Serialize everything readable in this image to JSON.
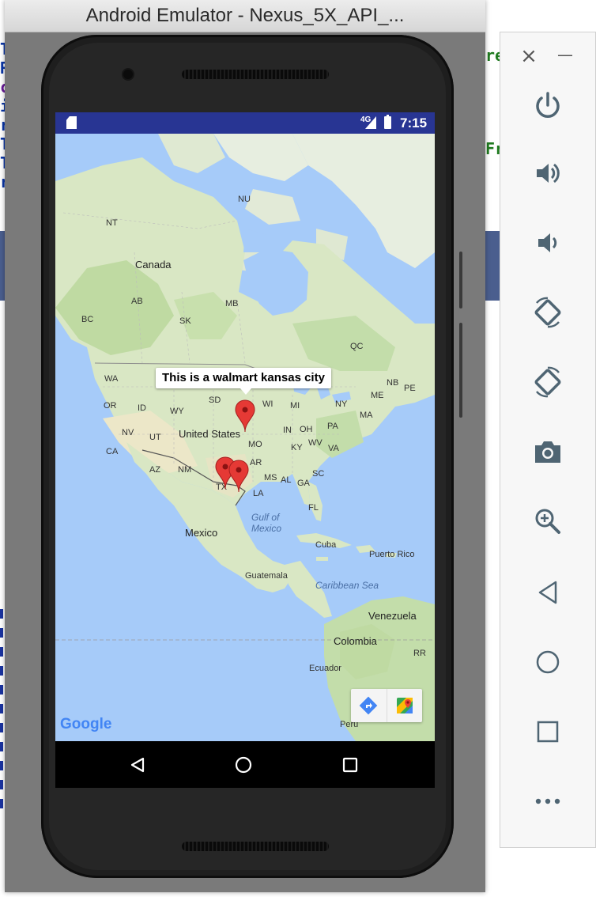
{
  "emulator": {
    "title": "Android Emulator - Nexus_5X_API_..."
  },
  "statusbar": {
    "time": "7:15",
    "network": "4G"
  },
  "map": {
    "labels": {
      "nu": "NU",
      "nt": "NT",
      "canada": "Canada",
      "ab": "AB",
      "mb": "MB",
      "bc": "BC",
      "sk": "SK",
      "qc": "QC",
      "wa": "WA",
      "nb": "NB",
      "pe": "PE",
      "me": "ME",
      "or": "OR",
      "id": "ID",
      "wy": "WY",
      "sd": "SD",
      "wi": "WI",
      "mi": "MI",
      "ny": "NY",
      "ma": "MA",
      "nv": "NV",
      "ut": "UT",
      "united_states": "United States",
      "in": "IN",
      "oh": "OH",
      "pa": "PA",
      "mo": "MO",
      "ky": "KY",
      "wv": "WV",
      "va": "VA",
      "ca": "CA",
      "az": "AZ",
      "nm": "NM",
      "ar": "AR",
      "ms": "MS",
      "al": "AL",
      "ga": "GA",
      "sc": "SC",
      "tx": "TX",
      "la": "LA",
      "fl": "FL",
      "gulf": "Gulf of",
      "mexico_water": "Mexico",
      "mexico": "Mexico",
      "cuba": "Cuba",
      "puerto_rico": "Puerto Rico",
      "guatemala": "Guatemala",
      "caribbean": "Caribbean Sea",
      "venezuela": "Venezuela",
      "colombia": "Colombia",
      "rr": "RR",
      "ecuador": "Ecuador",
      "peru": "Peru"
    },
    "info_window": "This is a walmart kansas city",
    "google_logo": "Google",
    "colors": {
      "water": "#a6cbf9",
      "land": "#d9e7c4",
      "forest": "#bfdaa2",
      "marker": "#e53935"
    }
  },
  "navbar": {
    "back_icon": "triangle-back-icon",
    "home_icon": "circle-home-icon",
    "recents_icon": "square-recents-icon"
  },
  "toolbar": {
    "close": "×",
    "minimize": "—"
  }
}
